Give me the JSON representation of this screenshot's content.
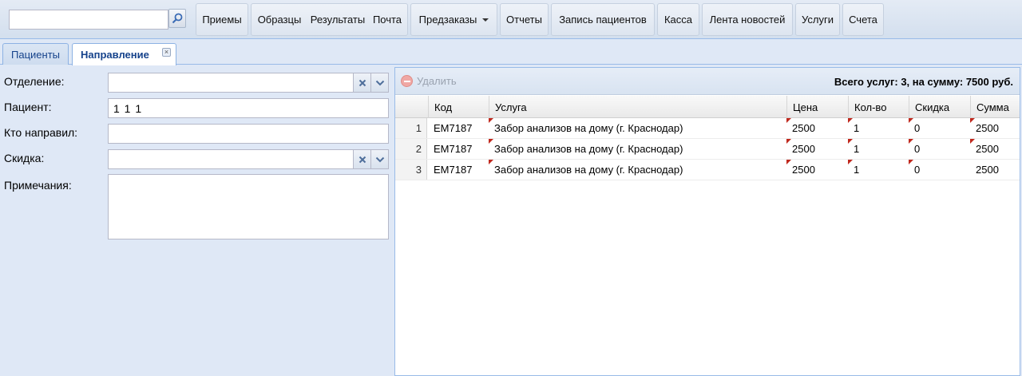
{
  "toolbar": {
    "search": {
      "value": "",
      "placeholder": ""
    },
    "buttons": [
      {
        "label": "Приемы"
      },
      {
        "label": "Образцы"
      },
      {
        "label": "Результаты"
      },
      {
        "label": "Почта"
      },
      {
        "label": "Предзаказы"
      },
      {
        "label": "Отчеты"
      },
      {
        "label": "Запись пациентов"
      },
      {
        "label": "Касса"
      },
      {
        "label": "Лента новостей"
      },
      {
        "label": "Услуги"
      },
      {
        "label": "Счета"
      }
    ]
  },
  "tabs": [
    {
      "label": "Пациенты"
    },
    {
      "label": "Направление"
    }
  ],
  "form": {
    "department": {
      "label": "Отделение:",
      "value": ""
    },
    "patient": {
      "label": "Пациент:",
      "value": "1 1 1"
    },
    "referrer": {
      "label": "Кто направил:",
      "value": ""
    },
    "discount": {
      "label": "Скидка:",
      "value": ""
    },
    "notes": {
      "label": "Примечания:",
      "value": ""
    }
  },
  "services": {
    "delete_label": "Удалить",
    "total": "Всего услуг: 3, на сумму: 7500 руб.",
    "columns": [
      "Код",
      "Услуга",
      "Цена",
      "Кол-во",
      "Скидка",
      "Сумма"
    ],
    "rows": [
      {
        "num": "1",
        "code": "EM7187",
        "service": "Забор анализов на дому (г. Краснодар)",
        "price": "2500",
        "qty": "1",
        "discount": "0",
        "sum": "2500"
      },
      {
        "num": "2",
        "code": "EM7187",
        "service": "Забор анализов на дому (г. Краснодар)",
        "price": "2500",
        "qty": "1",
        "discount": "0",
        "sum": "2500"
      },
      {
        "num": "3",
        "code": "EM7187",
        "service": "Забор анализов на дому (г. Краснодар)",
        "price": "2500",
        "qty": "1",
        "discount": "0",
        "sum": "2500"
      }
    ]
  }
}
